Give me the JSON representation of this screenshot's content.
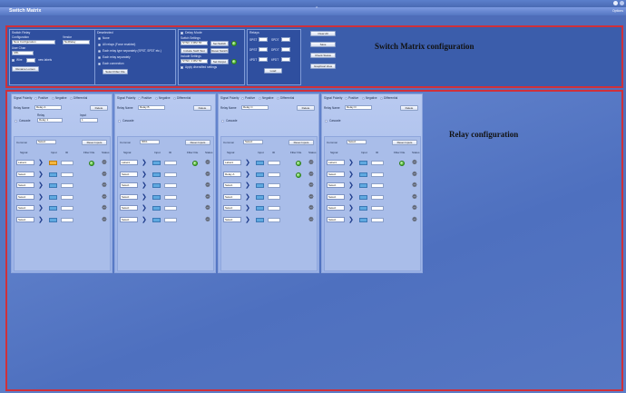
{
  "window": {
    "title": "Switch Matrix",
    "options": "Options"
  },
  "switch_relay": {
    "title": "Switch Relay",
    "configuration_label": "Configuration",
    "vendor_label": "Vendor",
    "configuration_value": "New Configuration",
    "vendor_value": "NetRelay",
    "user_chan_label": "User Chan",
    "user_chan_value": "ARL",
    "wire_label": "Wire",
    "new_label": "new labels",
    "rename_button": "Rename Lumen"
  },
  "deselect": {
    "title": "Deselected",
    "options": [
      "None",
      "All relays (Force enabled)",
      "Each relay type separately (SPST, SPDT etc.)",
      "Each relay separately",
      "Each connection"
    ],
    "button": "Select Filter File"
  },
  "delay_mode": {
    "title": "Delay Mode",
    "switch_settings": "Switch Settings",
    "value1": "SYNC 4 MM TR",
    "set_switch": "Set Switch",
    "include_switch": "Include Swift Test",
    "reset_switch": "Reset Switch",
    "include_settings": "Include Settings",
    "value2": "SYNC 4 MM TR",
    "set_output": "Set Output",
    "apply_label": "Apply diversified settings"
  },
  "relays_group": {
    "title": "Relays",
    "labels": [
      "SPST",
      "SPDT",
      "DPST",
      "DPDT",
      "4PDT",
      "6PDT"
    ],
    "load": "Load"
  },
  "actions": {
    "clear_all": "Clear All",
    "save": "Save",
    "check_status": "Check Status",
    "graphical_view": "Graphical View"
  },
  "callouts": {
    "switch_matrix": "Switch Matrix configuration",
    "relay": "Relay configuration"
  },
  "relays": [
    {
      "polarity_label": "Signal Polarity",
      "positive": "Positive",
      "negative": "Negative",
      "differential": "Differential",
      "name_label": "Relay Name",
      "name": "Relay A",
      "delete": "Delete",
      "cascade": "Cascade",
      "relay_label": "Relay",
      "relay_value": "Relay 1",
      "input_label": "Input",
      "input_value": "1",
      "common_label": "Common",
      "common_value": "Select",
      "reset": "Reset Inputs",
      "cols": [
        "Signal",
        "Input",
        "ID",
        "Filter File",
        "Status"
      ],
      "first": "Label1",
      "first2": "Select"
    },
    {
      "polarity_label": "Signal Polarity",
      "positive": "Positive",
      "negative": "Negative",
      "differential": "Differential",
      "name_label": "Relay Name",
      "name": "Relay B",
      "delete": "Delete",
      "cascade": "Cascade",
      "relay_label": "",
      "relay_value": "",
      "input_label": "",
      "input_value": "",
      "common_label": "Common",
      "common_value": "IDK1",
      "reset": "Reset Inputs",
      "cols": [
        "Signal",
        "Input",
        "ID",
        "Filter File",
        "Status"
      ],
      "first": "Label1",
      "first2": "Select"
    },
    {
      "polarity_label": "Signal Polarity",
      "positive": "Positive",
      "negative": "Negative",
      "differential": "Differential",
      "name_label": "Relay Name",
      "name": "Relay C",
      "delete": "Delete",
      "cascade": "Cascade",
      "relay_label": "",
      "relay_value": "",
      "input_label": "",
      "input_value": "",
      "common_label": "Common",
      "common_value": "Select",
      "reset": "Reset Inputs",
      "cols": [
        "Signal",
        "Input",
        "ID",
        "Filter File",
        "Status"
      ],
      "first": "Label1",
      "first2": "Relay A"
    },
    {
      "polarity_label": "Signal Polarity",
      "positive": "Positive",
      "negative": "Negative",
      "differential": "Differential",
      "name_label": "Relay Name",
      "name": "Relay D",
      "delete": "Delete",
      "cascade": "Cascade",
      "relay_label": "",
      "relay_value": "",
      "input_label": "",
      "input_value": "",
      "common_label": "Common",
      "common_value": "Select",
      "reset": "Reset Inputs",
      "cols": [
        "Signal",
        "Input",
        "ID",
        "Filter File",
        "Status"
      ],
      "first": "Label1",
      "first2": "Select"
    }
  ],
  "row_select": "Select",
  "row_slot": "1"
}
